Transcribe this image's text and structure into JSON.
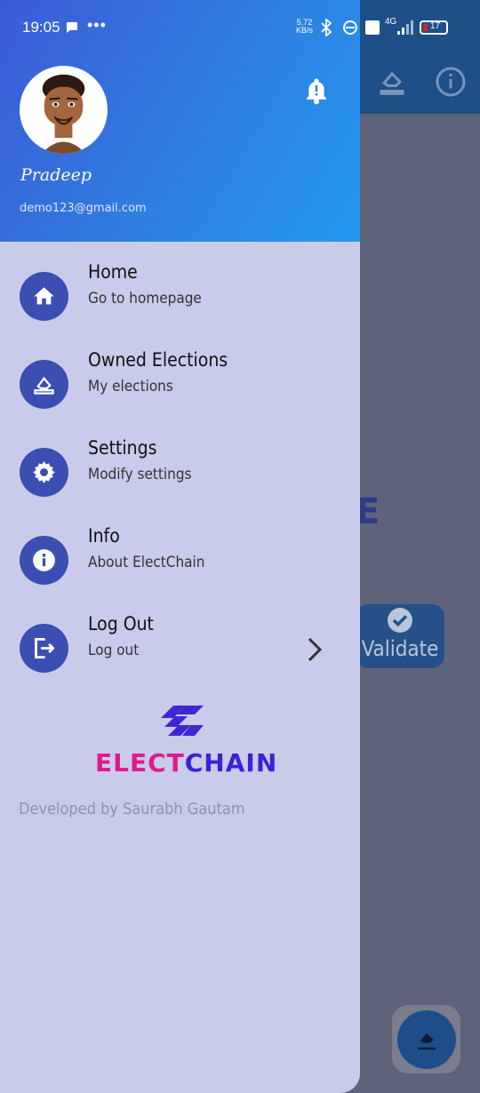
{
  "status_bar": {
    "time": "19:05",
    "net_rate_top": "5.72",
    "net_rate_bottom": "KB/s",
    "network": "4G",
    "battery": "17"
  },
  "drawer": {
    "user": {
      "name": "Pradeep",
      "email": "demo123@gmail.com"
    },
    "menu": [
      {
        "title": "Home",
        "subtitle": "Go to homepage",
        "icon": "home-icon"
      },
      {
        "title": "Owned Elections",
        "subtitle": "My elections",
        "icon": "ballot-icon"
      },
      {
        "title": "Settings",
        "subtitle": "Modify settings",
        "icon": "gear-icon"
      },
      {
        "title": "Info",
        "subtitle": "About ElectChain",
        "icon": "info-icon"
      },
      {
        "title": "Log Out",
        "subtitle": "Log out",
        "icon": "logout-icon"
      }
    ],
    "logo": {
      "part1": "ELECT",
      "part2": "CHAIN"
    },
    "footer": "Developed by Saurabh Gautam"
  },
  "background": {
    "partial_letter": "E",
    "validate_label": "Validate"
  },
  "colors": {
    "header_gradient_start": "#3b5bd8",
    "header_gradient_end": "#2297ef",
    "drawer_bg": "#c8cbe9",
    "icon_circle": "#3b4fb3",
    "logo_pink": "#e01a8c",
    "logo_blue": "#3c21d6"
  }
}
